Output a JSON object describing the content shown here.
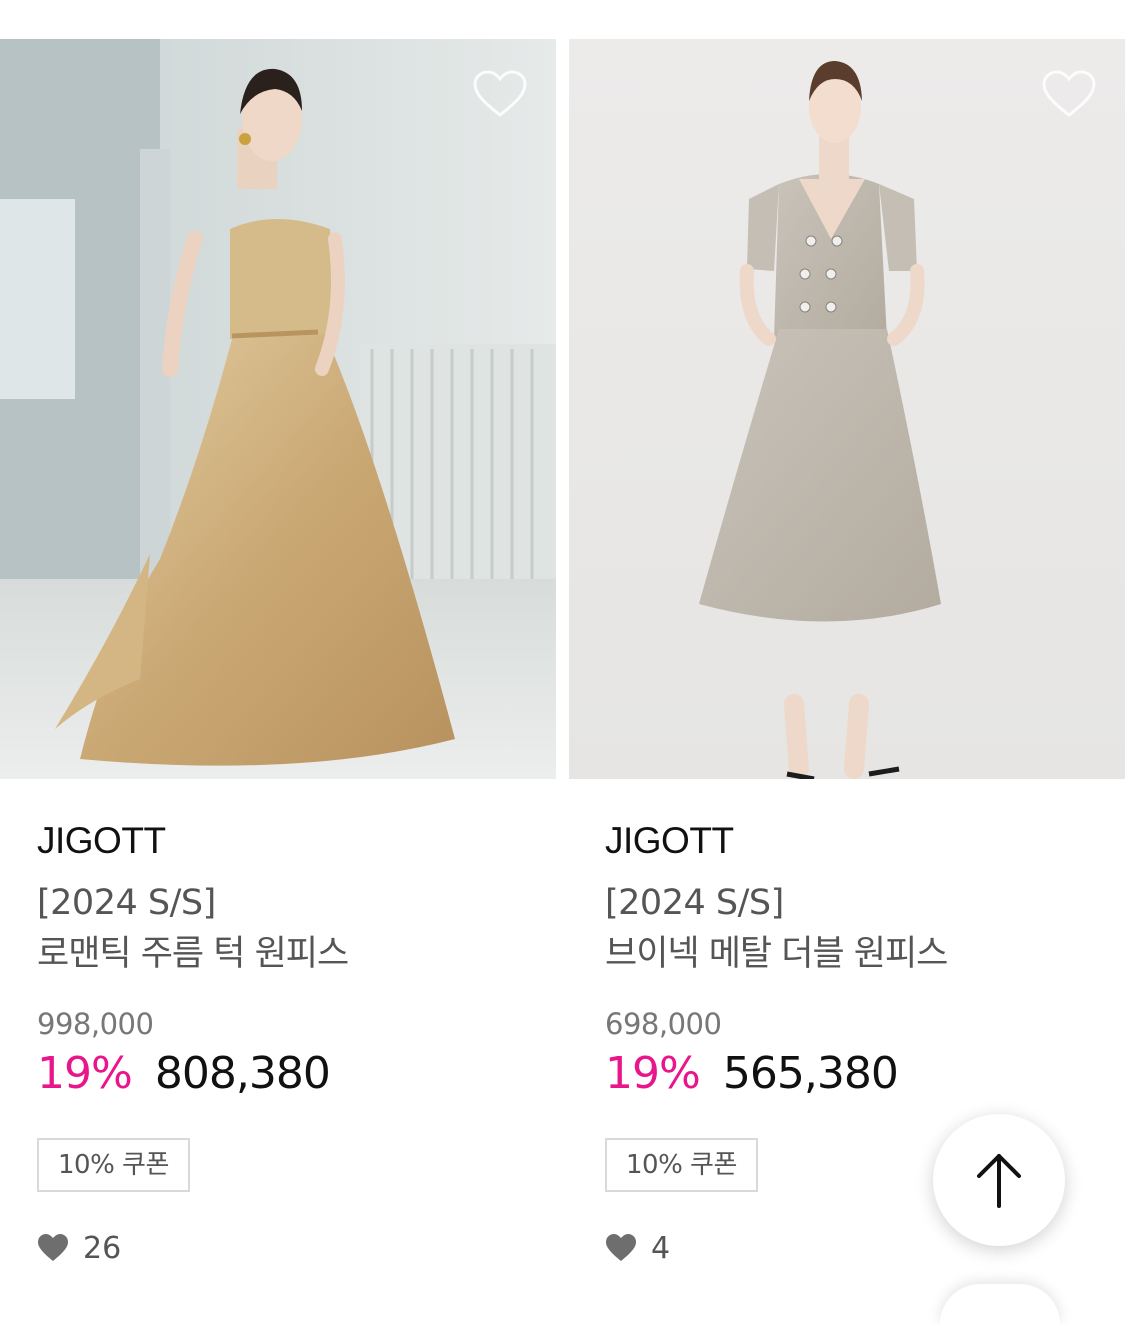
{
  "products": [
    {
      "brand": "JIGOTT",
      "season": "[2024 S/S]",
      "name": "로맨틱 주름 턱 원피스",
      "original_price": "998,000",
      "discount_rate": "19%",
      "sale_price": "808,380",
      "coupon": "10% 쿠폰",
      "likes": "26",
      "image": "model-in-gold-off-shoulder-dress"
    },
    {
      "brand": "JIGOTT",
      "season": "[2024 S/S]",
      "name": "브이넥 메탈 더블 원피스",
      "original_price": "698,000",
      "discount_rate": "19%",
      "sale_price": "565,380",
      "coupon": "10% 쿠폰",
      "likes": "4",
      "image": "model-in-grey-double-breasted-dress"
    }
  ],
  "icons": {
    "wishlist": "heart-outline-icon",
    "likes": "heart-filled-icon",
    "scroll_top": "arrow-up-icon"
  },
  "colors": {
    "discount": "#e8168a",
    "coupon_border": "#d9d9d9"
  }
}
